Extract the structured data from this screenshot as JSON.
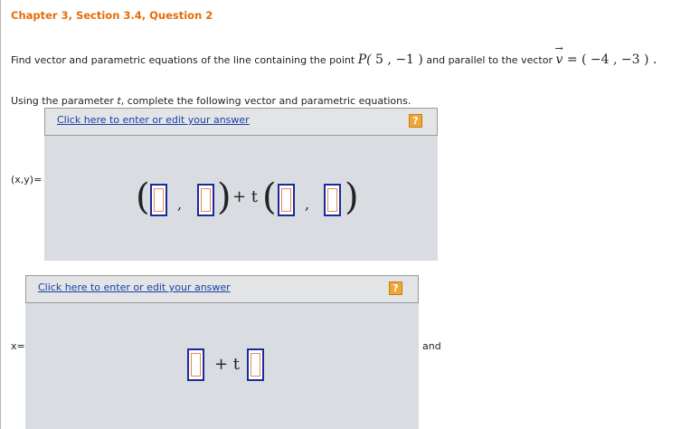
{
  "header": {
    "title": "Chapter 3, Section 3.4, Question 2"
  },
  "problem": {
    "text": "Find vector and parametric equations of the line containing the point",
    "point_name": "P(",
    "point_coords": " 5 ,  −1 )",
    "mid_text": " and parallel to the vector",
    "vector_name": "v",
    "vector_arrow": "→",
    "vector_value": " = ( −4 ,  −3 ) ."
  },
  "instruction": {
    "prefix": "Using the parameter ",
    "param": "t",
    "suffix": ", complete the following vector and parametric equations."
  },
  "answer1": {
    "link": "Click here to enter or edit your answer",
    "help": "?",
    "label": "(x,y)=",
    "open_paren": "(",
    "close_paren": ")",
    "comma": ",",
    "plus_t": "+ t"
  },
  "answer2": {
    "link": "Click here to enter or edit your answer",
    "help": "?",
    "label": "x=",
    "plus_t": "+ t",
    "and_text": "and"
  }
}
